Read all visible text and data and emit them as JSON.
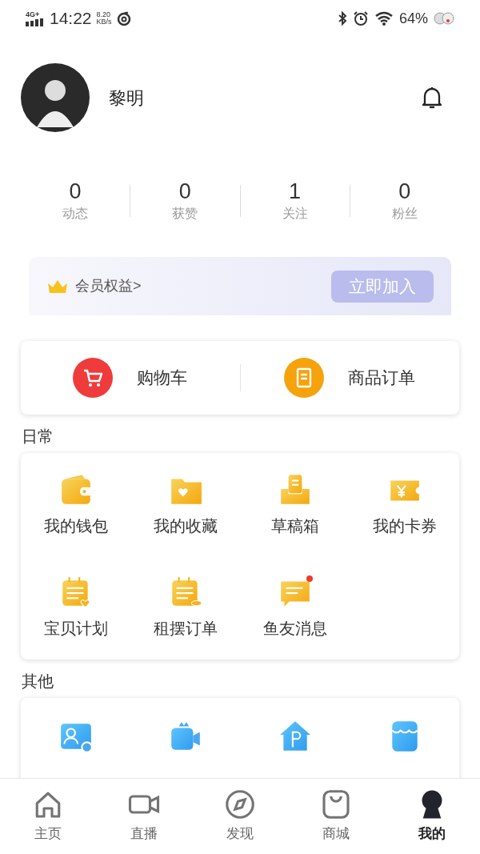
{
  "status_bar": {
    "network": "4G+",
    "time": "14:22",
    "speed_value": "8.20",
    "speed_unit": "KB/s",
    "battery": "64%"
  },
  "profile": {
    "name": "黎明"
  },
  "stats": [
    {
      "value": "0",
      "label": "动态"
    },
    {
      "value": "0",
      "label": "获赞"
    },
    {
      "value": "1",
      "label": "关注"
    },
    {
      "value": "0",
      "label": "粉丝"
    }
  ],
  "membership": {
    "label": "会员权益>",
    "button": "立即加入"
  },
  "shop": [
    {
      "label": "购物车",
      "color": "#ef3b3b"
    },
    {
      "label": "商品订单",
      "color": "#f5a20c"
    }
  ],
  "daily": {
    "title": "日常",
    "items": [
      {
        "label": "我的钱包",
        "badge": false
      },
      {
        "label": "我的收藏",
        "badge": false
      },
      {
        "label": "草稿箱",
        "badge": false
      },
      {
        "label": "我的卡券",
        "badge": false
      },
      {
        "label": "宝贝计划",
        "badge": false
      },
      {
        "label": "租摆订单",
        "badge": false
      },
      {
        "label": "鱼友消息",
        "badge": true
      }
    ]
  },
  "other": {
    "title": "其他"
  },
  "tab_bar": [
    {
      "label": "主页",
      "selected": false
    },
    {
      "label": "直播",
      "selected": false
    },
    {
      "label": "发现",
      "selected": false
    },
    {
      "label": "商城",
      "selected": false
    },
    {
      "label": "我的",
      "selected": true
    }
  ]
}
